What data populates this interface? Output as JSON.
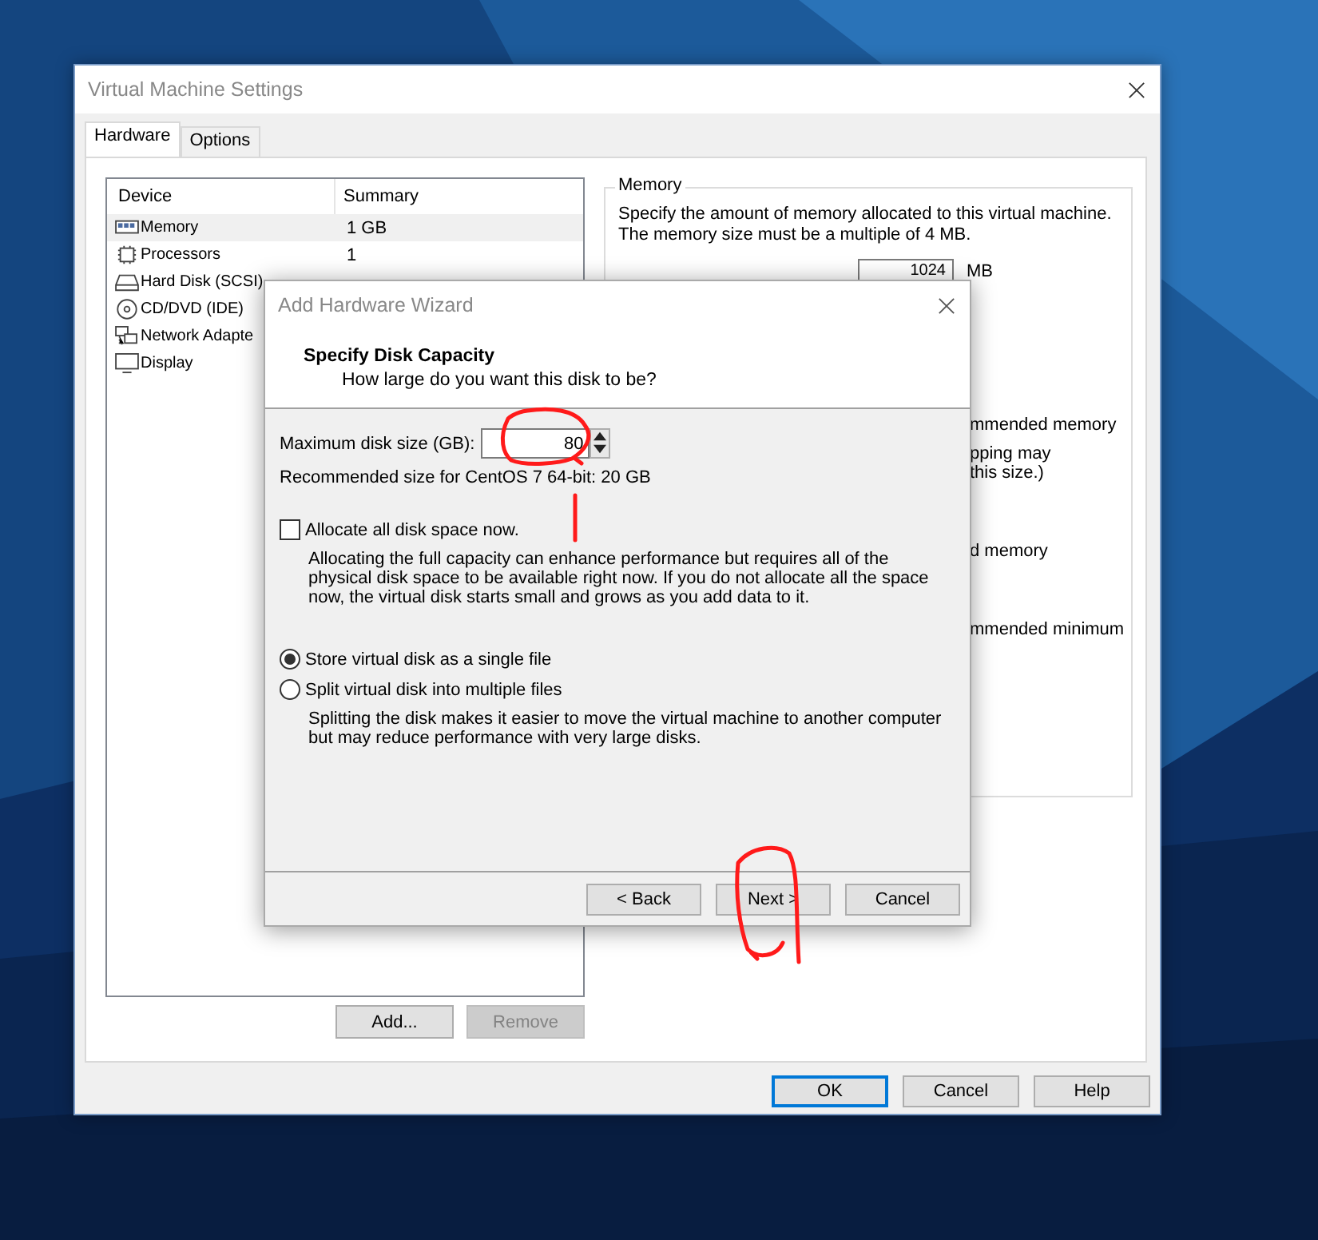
{
  "settings_window": {
    "title": "Virtual Machine Settings",
    "tabs": [
      {
        "label": "Hardware",
        "selected": true
      },
      {
        "label": "Options",
        "selected": false
      }
    ],
    "device_table": {
      "columns": [
        "Device",
        "Summary"
      ],
      "rows": [
        {
          "kind": "memory",
          "device": "Memory",
          "summary": "1 GB",
          "selected": true
        },
        {
          "kind": "cpu",
          "device": "Processors",
          "summary": "1",
          "selected": false
        },
        {
          "kind": "disk",
          "device": "Hard Disk (SCSI)",
          "selected": false
        },
        {
          "kind": "cd",
          "device": "CD/DVD (IDE)",
          "selected": false
        },
        {
          "kind": "network",
          "device": "Network Adapte",
          "selected": false
        },
        {
          "kind": "display",
          "device": "Display",
          "selected": false
        }
      ]
    },
    "list_buttons": [
      {
        "label": "Add...",
        "disabled": false
      },
      {
        "label": "Remove",
        "disabled": true
      }
    ],
    "memory_panel": {
      "title": "Memory",
      "description": "Specify the amount of memory allocated to this virtual machine. The memory size must be a multiple of 4 MB.",
      "value": "1024",
      "unit": "MB",
      "fragments": [
        "mmended memory",
        "pping may",
        "this size.)",
        "d memory",
        "mmended minimum"
      ]
    },
    "buttons": [
      {
        "label": "OK",
        "default": true
      },
      {
        "label": "Cancel",
        "default": false
      },
      {
        "label": "Help",
        "default": false
      }
    ]
  },
  "wizard": {
    "title": "Add Hardware Wizard",
    "heading": "Specify Disk Capacity",
    "subheading": "How large do you want this disk to be?",
    "size_label": "Maximum disk size (GB):",
    "size_value": "80",
    "recommended": "Recommended size for CentOS 7 64-bit: 20 GB",
    "allocate": {
      "label": "Allocate all disk space now.",
      "checked": false,
      "description": "Allocating the full capacity can enhance performance but requires all of the physical disk space to be available right now. If you do not allocate all the space now, the virtual disk starts small and grows as you add data to it."
    },
    "storage_options": [
      {
        "label": "Store virtual disk as a single file",
        "selected": true
      },
      {
        "label": "Split virtual disk into multiple files",
        "selected": false
      }
    ],
    "split_description": "Splitting the disk makes it easier to move the virtual machine to another computer but may reduce performance with very large disks.",
    "buttons": [
      {
        "label": "< Back",
        "default": false
      },
      {
        "label": "Next >",
        "default": false
      },
      {
        "label": "Cancel",
        "default": false
      }
    ]
  }
}
